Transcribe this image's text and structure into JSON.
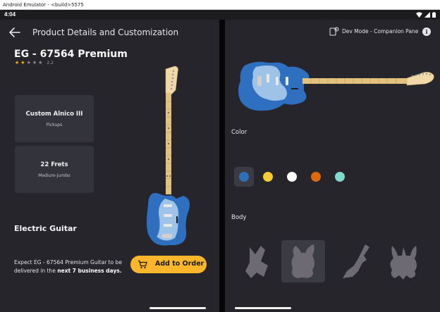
{
  "window": {
    "title": "Android Emulator - <build>5575"
  },
  "status_bar": {
    "time": "4:04"
  },
  "left_pane": {
    "screen_title": "Product Details and Customization",
    "product_name": "EG - 67564 Premium",
    "rating": {
      "value": "2.2",
      "stars_filled": 2,
      "stars_total": 5
    },
    "specs": [
      {
        "title": "Custom Alnico III",
        "subtitle": "Pickups"
      },
      {
        "title": "22 Frets",
        "subtitle": "Medium-Jumbo"
      }
    ],
    "category": "Electric Guitar",
    "delivery": {
      "prefix": "Expect EG - 67564 Premium Guitar to be delivered in the ",
      "highlight": "next 7 business days."
    },
    "order_button": "Add to Order"
  },
  "right_pane": {
    "dev_mode_label": "Dev Mode - Companion Pane",
    "info_label": "i",
    "color_label": "Color",
    "colors": [
      {
        "name": "blue",
        "hex": "#2f6fb8",
        "selected": true
      },
      {
        "name": "yellow",
        "hex": "#f7cc33",
        "selected": false
      },
      {
        "name": "white",
        "hex": "#ffffff",
        "selected": false
      },
      {
        "name": "orange",
        "hex": "#e0690c",
        "selected": false
      },
      {
        "name": "teal",
        "hex": "#7fd9cd",
        "selected": false
      }
    ],
    "body_label": "Body",
    "bodies": [
      {
        "name": "explorer-body",
        "selected": false
      },
      {
        "name": "stratocaster-body",
        "selected": true
      },
      {
        "name": "flying-v-body",
        "selected": false
      },
      {
        "name": "super-strat-body",
        "selected": false
      }
    ]
  },
  "theme": {
    "background": "#25252b",
    "card": "#33343b",
    "accent": "#fbb62c",
    "star": "#f2b705"
  }
}
